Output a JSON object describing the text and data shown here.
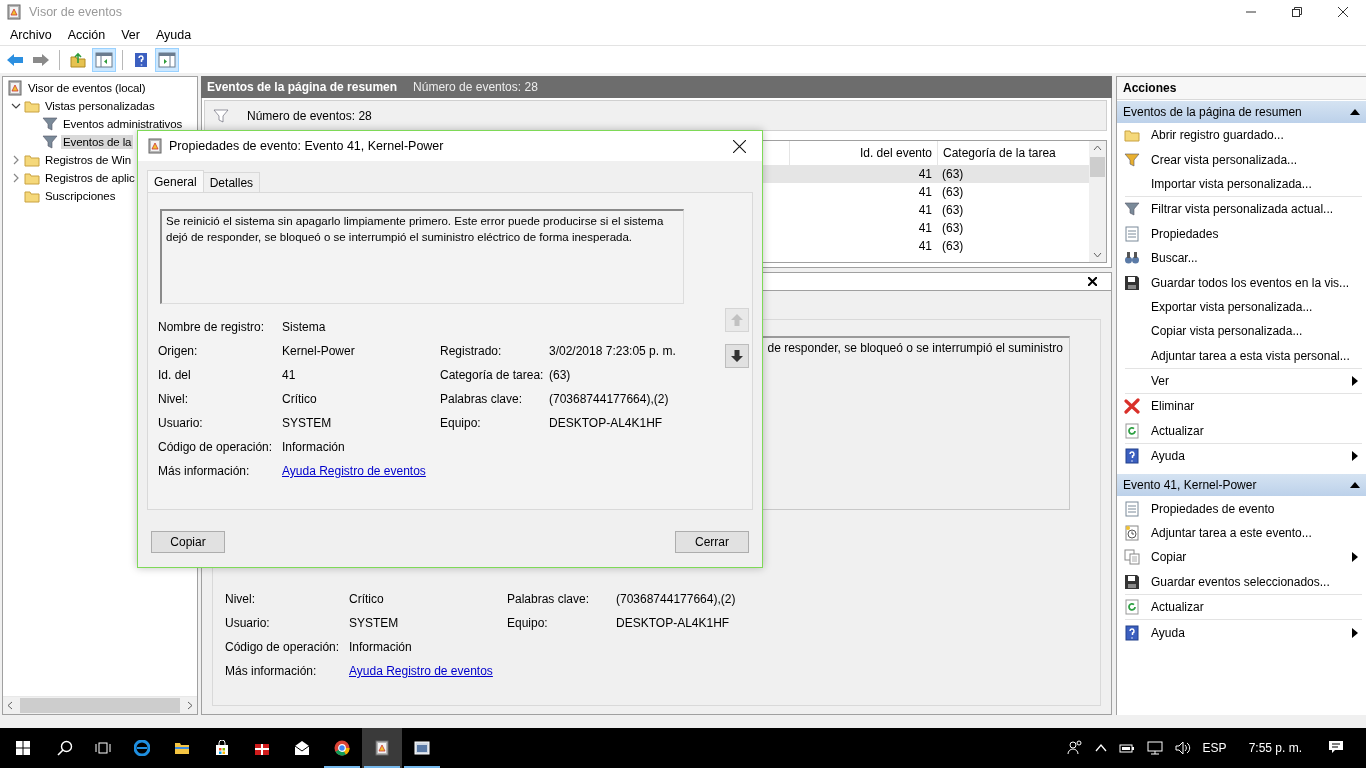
{
  "window": {
    "title": "Visor de eventos"
  },
  "menu": [
    "Archivo",
    "Acción",
    "Ver",
    "Ayuda"
  ],
  "toolbar": [
    {
      "pressed": false
    },
    {
      "pressed": false
    },
    {
      "pressed": false
    },
    {
      "pressed": true
    },
    {
      "pressed": false
    },
    {
      "pressed": true
    }
  ],
  "tree": [
    {
      "label": "Visor de eventos (local)",
      "selected": false,
      "children": [
        {
          "label": "Vistas personalizadas",
          "selected": false,
          "expanded": true,
          "children": [
            {
              "label": "Eventos administrativos",
              "selected": false
            },
            {
              "label": "Eventos de la",
              "selected": true
            }
          ]
        },
        {
          "label": "Registros de Win",
          "selected": false,
          "expanded": false
        },
        {
          "label": "Registros de aplic",
          "selected": false,
          "expanded": false
        },
        {
          "label": "Suscripciones",
          "selected": false
        }
      ]
    }
  ],
  "center": {
    "header": {
      "title": "Eventos de la página de resumen",
      "count": "Número de eventos: 28"
    },
    "filter_text": "Número de eventos: 28",
    "table": {
      "columns": [
        "Id. del evento",
        "Categoría de la tarea"
      ],
      "rows": [
        {
          "cells": [
            "41",
            "(63)"
          ],
          "selected": true
        },
        {
          "cells": [
            "41",
            "(63)"
          ],
          "selected": false
        },
        {
          "cells": [
            "41",
            "(63)"
          ],
          "selected": false
        },
        {
          "cells": [
            "41",
            "(63)"
          ],
          "selected": false
        },
        {
          "cells": [
            "41",
            "(63)"
          ],
          "selected": false
        }
      ]
    },
    "details": {
      "description": "de responder, se bloqueó o se interrumpió el suministro",
      "rows": [
        {
          "left": {
            "label": "Nivel:",
            "value": "Crítico"
          },
          "right": {
            "label": "Palabras clave:",
            "value": "(70368744177664),(2)"
          }
        },
        {
          "left": {
            "label": "Usuario:",
            "value": "SYSTEM"
          },
          "right": {
            "label": "Equipo:",
            "value": "DESKTOP-AL4K1HF"
          }
        },
        {
          "left": {
            "label": "Código de operación:",
            "value": "Información"
          }
        },
        {
          "left": {
            "label": "Más información:",
            "link": "Ayuda Registro de eventos"
          }
        }
      ]
    }
  },
  "actions": {
    "title": "Acciones",
    "sections": [
      {
        "title": "Eventos de la página de resumen",
        "expanded": true,
        "groups": [
          [
            {
              "label": "Abrir registro guardado...",
              "submenu": false
            },
            {
              "label": "Crear vista personalizada...",
              "submenu": false
            },
            {
              "label": "Importar vista personalizada...",
              "submenu": false
            }
          ],
          [
            {
              "label": "Filtrar vista personalizada actual...",
              "submenu": false
            },
            {
              "label": "Propiedades",
              "submenu": false
            },
            {
              "label": "Buscar...",
              "submenu": false
            },
            {
              "label": "Guardar todos los eventos en la vis...",
              "submenu": false
            },
            {
              "label": "Exportar vista personalizada...",
              "submenu": false
            },
            {
              "label": "Copiar vista personalizada...",
              "submenu": false
            },
            {
              "label": "Adjuntar tarea a esta vista personal...",
              "submenu": false
            }
          ],
          [
            {
              "label": "Ver",
              "submenu": true
            }
          ],
          [
            {
              "label": "Eliminar",
              "submenu": false
            },
            {
              "label": "Actualizar",
              "submenu": false
            }
          ],
          [
            {
              "label": "Ayuda",
              "submenu": true
            }
          ]
        ]
      },
      {
        "title": "Evento 41, Kernel-Power",
        "expanded": true,
        "groups": [
          [
            {
              "label": "Propiedades de evento",
              "submenu": false
            },
            {
              "label": "Adjuntar tarea a este evento...",
              "submenu": false
            },
            {
              "label": "Copiar",
              "submenu": true
            },
            {
              "label": "Guardar eventos seleccionados...",
              "submenu": false
            }
          ],
          [
            {
              "label": "Actualizar",
              "submenu": false
            }
          ],
          [
            {
              "label": "Ayuda",
              "submenu": true
            }
          ]
        ]
      }
    ]
  },
  "dialog": {
    "title": "Propiedades de evento: Evento 41, Kernel-Power",
    "tabs": [
      {
        "label": "General",
        "selected": true
      },
      {
        "label": "Detalles",
        "selected": false
      }
    ],
    "description": "Se reinició el sistema sin apagarlo limpiamente primero. Este error puede producirse si el sistema dejó de responder, se bloqueó o se interrumpió el suministro eléctrico de forma inesperada.",
    "rows": [
      {
        "left": {
          "label": "Nombre de registro:",
          "value": "Sistema"
        }
      },
      {
        "left": {
          "label": "Origen:",
          "value": "Kernel-Power"
        },
        "right": {
          "label": "Registrado:",
          "value": "3/02/2018 7:23:05 p. m."
        }
      },
      {
        "left": {
          "label": "Id. del",
          "value": "41"
        },
        "right": {
          "label": "Categoría de tarea:",
          "value": "(63)"
        }
      },
      {
        "left": {
          "label": "Nivel:",
          "value": "Crítico"
        },
        "right": {
          "label": "Palabras clave:",
          "value": "(70368744177664),(2)"
        }
      },
      {
        "left": {
          "label": "Usuario:",
          "value": "SYSTEM"
        },
        "right": {
          "label": "Equipo:",
          "value": "DESKTOP-AL4K1HF"
        }
      },
      {
        "left": {
          "label": "Código de operación:",
          "value": "Información"
        }
      },
      {
        "left": {
          "label": "Más información:",
          "link": "Ayuda Registro de eventos"
        }
      }
    ],
    "navigation": [
      {
        "disabled": true
      },
      {
        "disabled": false
      }
    ],
    "buttons": [
      "Copiar",
      "Cerrar"
    ]
  },
  "taskbar": {
    "apps": [
      {
        "running": false,
        "active": false
      },
      {
        "running": false,
        "active": false
      },
      {
        "running": false,
        "active": false
      },
      {
        "running": false,
        "active": false
      },
      {
        "running": false,
        "active": false
      },
      {
        "running": true,
        "active": false
      },
      {
        "running": true,
        "active": true
      },
      {
        "running": true,
        "active": false
      }
    ],
    "language": "ESP",
    "time": "7:55 p. m."
  }
}
